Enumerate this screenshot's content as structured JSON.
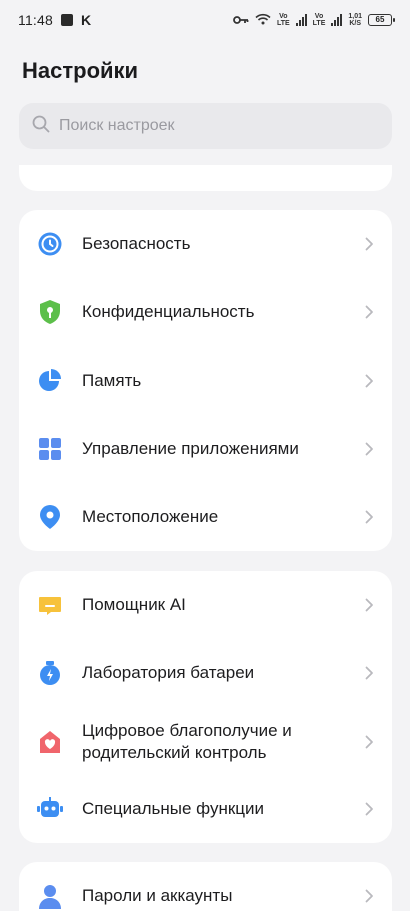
{
  "status_bar": {
    "time": "11:48",
    "k_label": "K",
    "vo_lte_1_top": "Vo",
    "vo_lte_1_bottom": "LTE",
    "vo_lte_2_top": "Vo",
    "vo_lte_2_bottom": "LTE",
    "speed_value": "1,01",
    "speed_unit": "K/S",
    "battery": "65"
  },
  "header": {
    "title": "Настройки"
  },
  "search": {
    "placeholder": "Поиск настроек"
  },
  "groups": [
    {
      "items": [
        {
          "label": "Безопасность",
          "icon": "security-icon"
        },
        {
          "label": "Конфиденциальность",
          "icon": "privacy-shield-icon"
        },
        {
          "label": "Память",
          "icon": "storage-pie-icon"
        },
        {
          "label": "Управление приложениями",
          "icon": "apps-grid-icon"
        },
        {
          "label": "Местоположение",
          "icon": "location-pin-icon"
        }
      ]
    },
    {
      "items": [
        {
          "label": "Помощник AI",
          "icon": "ai-assistant-icon"
        },
        {
          "label": "Лаборатория батареи",
          "icon": "battery-lab-icon"
        },
        {
          "label": "Цифровое благополучие и родительский контроль",
          "icon": "wellbeing-icon"
        },
        {
          "label": "Специальные функции",
          "icon": "accessibility-robot-icon"
        }
      ]
    },
    {
      "items": [
        {
          "label": "Пароли и аккаунты",
          "icon": "accounts-person-icon"
        }
      ]
    }
  ],
  "colors": {
    "background": "#f3f3f5",
    "card": "#ffffff",
    "blue": "#3d8ef2",
    "green": "#5cbf4a",
    "yellow": "#f7c23b",
    "red": "#f0656c"
  }
}
